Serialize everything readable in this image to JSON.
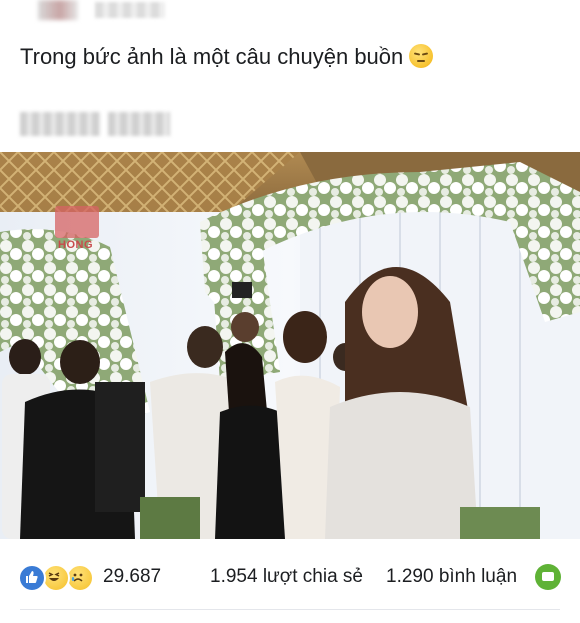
{
  "post": {
    "text": "Trong bức ảnh là một câu chuyện buồn",
    "emoji": "pensive-face-emoji"
  },
  "photo": {
    "watermark_text": "HONG"
  },
  "stats": {
    "reaction_count": "29.687",
    "shares": "1.954 lượt chia sẻ",
    "comments": "1.290 bình luận",
    "reaction_icons": [
      "like-icon",
      "haha-icon",
      "sad-icon"
    ]
  },
  "colors": {
    "like_blue": "#3a7bd5",
    "comment_green": "#5fb236",
    "text": "#1c1e21"
  }
}
